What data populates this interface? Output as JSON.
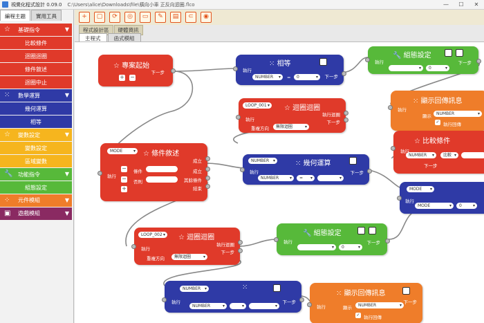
{
  "window": {
    "title": "視覺化程式設計 0.09.0",
    "path": "C:\\Users\\alice\\Downloads\\file\\橫向小車 正反向迴圈.flco",
    "controls": [
      "—",
      "☐",
      "✕"
    ]
  },
  "sidebar": {
    "tabs": [
      "編程主題",
      "實用工具"
    ],
    "items": [
      {
        "label": "基礎指令",
        "type": "cat",
        "color": "#e03a2a",
        "icon": "☆"
      },
      {
        "label": "比較條件",
        "type": "item",
        "color": "#e03a2a"
      },
      {
        "label": "迴圈迴圈",
        "type": "item",
        "color": "#e03a2a"
      },
      {
        "label": "條件敘述",
        "type": "item",
        "color": "#e03a2a"
      },
      {
        "label": "迴圈中止",
        "type": "item",
        "color": "#e03a2a"
      },
      {
        "label": "數學運算",
        "type": "cat",
        "color": "#2f3aa6",
        "icon": "⁙"
      },
      {
        "label": "幾何運算",
        "type": "item",
        "color": "#2f3aa6"
      },
      {
        "label": "相等",
        "type": "item",
        "color": "#2f3aa6"
      },
      {
        "label": "變數設定",
        "type": "cat",
        "color": "#f6b51e",
        "icon": "☆"
      },
      {
        "label": "變數設定",
        "type": "item",
        "color": "#f6b51e"
      },
      {
        "label": "區域變數",
        "type": "item",
        "color": "#f6b51e"
      },
      {
        "label": "功能指令",
        "type": "cat",
        "color": "#57b93a",
        "icon": "🔧"
      },
      {
        "label": "組態設定",
        "type": "item",
        "color": "#57b93a"
      },
      {
        "label": "元件模組",
        "type": "cat",
        "color": "#ef7d2a",
        "icon": "⁘"
      },
      {
        "label": "遊戲模組",
        "type": "cat",
        "color": "#8a2a62",
        "icon": "▣"
      }
    ]
  },
  "toolbar": {
    "buttons": [
      "+",
      "▢",
      "⟳",
      "◎",
      "▭",
      "✎",
      "▤",
      "⊂",
      "◉"
    ]
  },
  "upper_tabs": [
    "程式設計區",
    "硬體資訊"
  ],
  "canvas_tabs": [
    "主程式",
    "函式模組"
  ],
  "blocks": {
    "start": {
      "title": "專案起始",
      "next": "下一步"
    },
    "equal": {
      "title": "相等",
      "prev": "執行",
      "next": "下一步",
      "type": "NUMBER",
      "op": "=",
      "val": "0"
    },
    "setting1": {
      "title": "組態設定",
      "prev": "執行",
      "next": "下一步",
      "val": "0"
    },
    "loop1": {
      "title": "迴圈迴圈",
      "mode": "LOOP_001",
      "prev": "執行",
      "loop": "執行迴圈",
      "next": "下一步",
      "dir_label": "重複方向",
      "dir": "無限迴圈"
    },
    "show1": {
      "title": "顯示回傳訊息",
      "prev": "執行",
      "show": "顯示",
      "type": "NUMBER",
      "next": "下一步",
      "check": "執行回傳"
    },
    "cond": {
      "title": "條件敘述",
      "mode": "MODE",
      "prev": "執行",
      "cond_label": "條件",
      "else_label": "否則",
      "ok": "成立",
      "ok2": "成立",
      "other": "其餘條件",
      "end": "結束"
    },
    "compare": {
      "title": "比較條件",
      "prev": "執行",
      "show": "顯示",
      "type": "NUMBER",
      "op": "比較",
      "next": "下一步"
    },
    "geom": {
      "title": "幾何運算",
      "mode": "NUMBER",
      "prev": "執行",
      "type": "NUMBER",
      "op": "=",
      "next": "下一步"
    },
    "right_blue": {
      "mode": "MODE",
      "prev": "執行",
      "type": "MODE",
      "val": "0"
    },
    "loop2": {
      "title": "迴圈迴圈",
      "mode": "LOOP_002",
      "prev": "執行",
      "loop": "執行迴圈",
      "next": "下一步",
      "dir_label": "重複方向",
      "dir": "無限迴圈"
    },
    "setting2": {
      "title": "組態設定",
      "prev": "執行",
      "next": "下一步",
      "val": "0"
    },
    "var_blue": {
      "mode": "NUMBER",
      "prev": "執行",
      "type": "NUMBER",
      "next": "下一步"
    },
    "show2": {
      "title": "顯示回傳訊息",
      "prev": "執行",
      "show": "顯示",
      "type": "NUMBER",
      "next": "下一步",
      "check": "執行回傳"
    }
  }
}
